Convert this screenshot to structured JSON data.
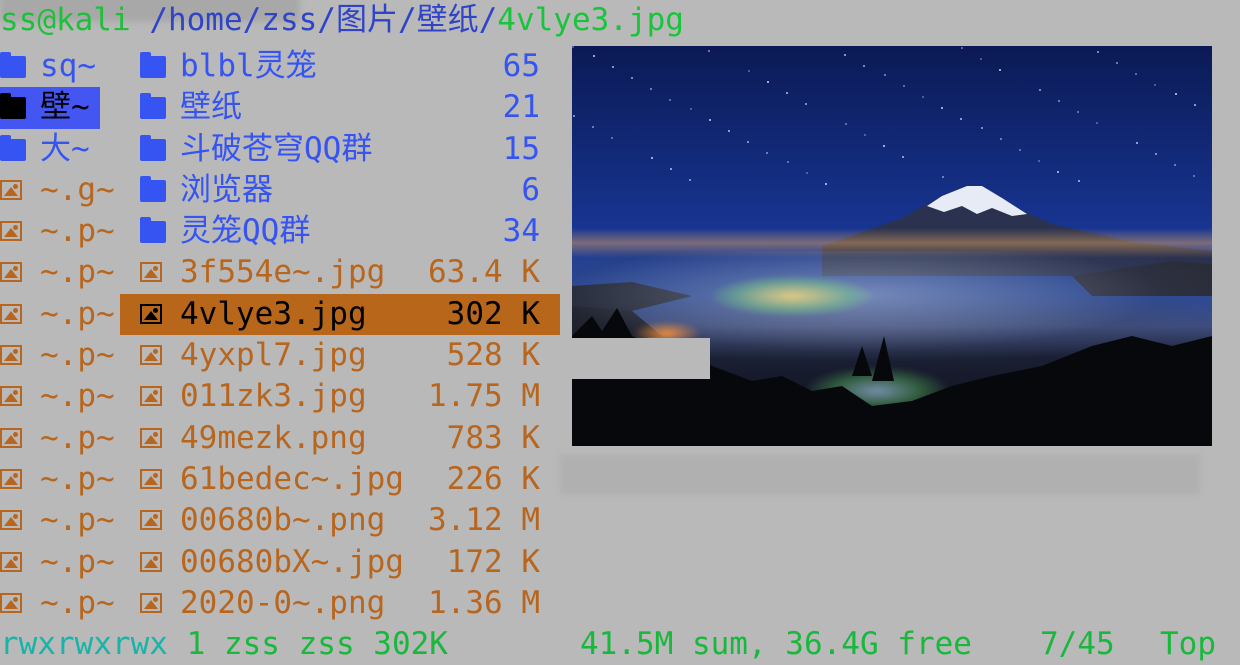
{
  "title": {
    "user_host": "ss@kali",
    "path": " /home/zss/图片/壁纸/",
    "file": "4vlye3.jpg"
  },
  "parent_column": [
    {
      "type": "dir",
      "label": "sq~"
    },
    {
      "type": "dir",
      "label": "壁~",
      "selected": true
    },
    {
      "type": "dir",
      "label": "大~"
    },
    {
      "type": "image",
      "label": "~.g~"
    },
    {
      "type": "image",
      "label": "~.p~"
    },
    {
      "type": "image",
      "label": "~.p~"
    },
    {
      "type": "image",
      "label": "~.p~"
    },
    {
      "type": "image",
      "label": "~.p~"
    },
    {
      "type": "image",
      "label": "~.p~"
    },
    {
      "type": "image",
      "label": "~.p~"
    },
    {
      "type": "image",
      "label": "~.p~"
    },
    {
      "type": "image",
      "label": "~.p~"
    },
    {
      "type": "image",
      "label": "~.p~"
    },
    {
      "type": "image",
      "label": "~.p~"
    }
  ],
  "current_column": [
    {
      "type": "dir",
      "name": "blbl灵笼",
      "size": "65"
    },
    {
      "type": "dir",
      "name": "壁纸",
      "size": "21"
    },
    {
      "type": "dir",
      "name": "斗破苍穹QQ群",
      "size": "15"
    },
    {
      "type": "dir",
      "name": "浏览器",
      "size": "6"
    },
    {
      "type": "dir",
      "name": "灵笼QQ群",
      "size": "34"
    },
    {
      "type": "image",
      "name": "3f554e~.jpg",
      "size": "63.4 K"
    },
    {
      "type": "image",
      "name": "4vlye3.jpg",
      "size": "302 K",
      "selected": true
    },
    {
      "type": "image",
      "name": "4yxpl7.jpg",
      "size": "528 K"
    },
    {
      "type": "image",
      "name": "011zk3.jpg",
      "size": "1.75 M"
    },
    {
      "type": "image",
      "name": "49mezk.png",
      "size": "783 K"
    },
    {
      "type": "image",
      "name": "61bedec~.jpg",
      "size": "226 K"
    },
    {
      "type": "image",
      "name": "00680b~.png",
      "size": "3.12 M"
    },
    {
      "type": "image",
      "name": "00680bX~.jpg",
      "size": "172 K"
    },
    {
      "type": "image",
      "name": "2020-0~.png",
      "size": "1.36 M"
    }
  ],
  "status": {
    "permissions": "rwxrwxrwx",
    "details": " 1 zss zss 302K",
    "sum_free": "41.5M sum, 36.4G free",
    "position": "7/45",
    "scroll": "Top"
  },
  "colors": {
    "directory": "#3554f2",
    "image_file": "#b8661e",
    "selection_file": "#b86619",
    "selection_dir": "#4456f2",
    "status_green": "#18b83c"
  },
  "icons": {
    "directory": "folder-icon",
    "image_file": "image-file-icon"
  }
}
